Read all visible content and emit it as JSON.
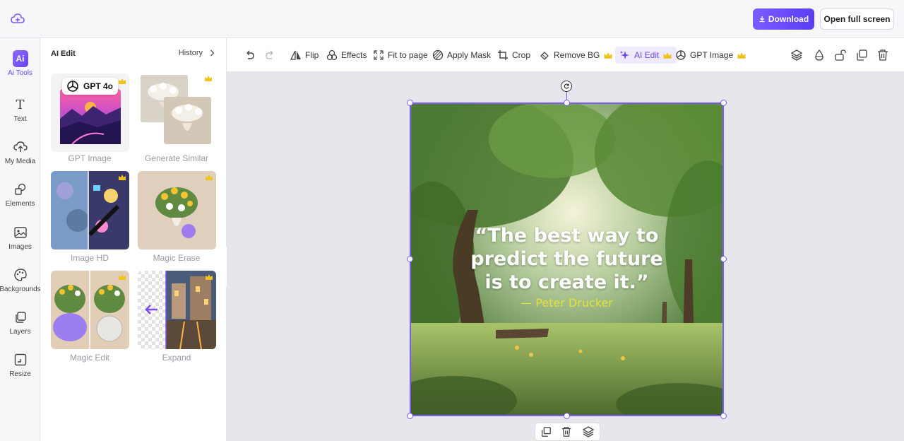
{
  "topbar": {
    "logo_icon": "cloud-sparkle-icon",
    "download_label": "Download",
    "open_fullscreen_label": "Open full screen"
  },
  "rail": {
    "items": [
      {
        "label": "Ai Tools",
        "icon": "ai-badge-icon",
        "active": true
      },
      {
        "label": "Text",
        "icon": "text-icon"
      },
      {
        "label": "My Media",
        "icon": "upload-cloud-icon"
      },
      {
        "label": "Elements",
        "icon": "shapes-icon"
      },
      {
        "label": "Images",
        "icon": "image-icon"
      },
      {
        "label": "Backgrounds",
        "icon": "palette-icon"
      },
      {
        "label": "Layers",
        "icon": "layers-icon"
      },
      {
        "label": "Resize",
        "icon": "resize-icon"
      }
    ]
  },
  "panel": {
    "title": "AI Edit",
    "history_label": "History",
    "tiles": [
      {
        "label": "GPT Image",
        "badge": "GPT 4o"
      },
      {
        "label": "Generate Similar"
      },
      {
        "label": "Image HD"
      },
      {
        "label": "Magic Erase"
      },
      {
        "label": "Magic Edit"
      },
      {
        "label": "Expand"
      }
    ]
  },
  "toolbar": {
    "flip": "Flip",
    "effects": "Effects",
    "fit_to_page": "Fit to page",
    "apply_mask": "Apply Mask",
    "crop": "Crop",
    "remove_bg": "Remove BG",
    "ai_edit": "AI Edit",
    "gpt_image": "GPT Image"
  },
  "canvas": {
    "quote_line1": "“The best way to",
    "quote_line2": "predict the future",
    "quote_line3": "is to create it.”",
    "author": "— Peter Drucker"
  },
  "colors": {
    "accent": "#6a42f0",
    "quote_author": "#e6e23a",
    "crown": "#f2c31b"
  }
}
